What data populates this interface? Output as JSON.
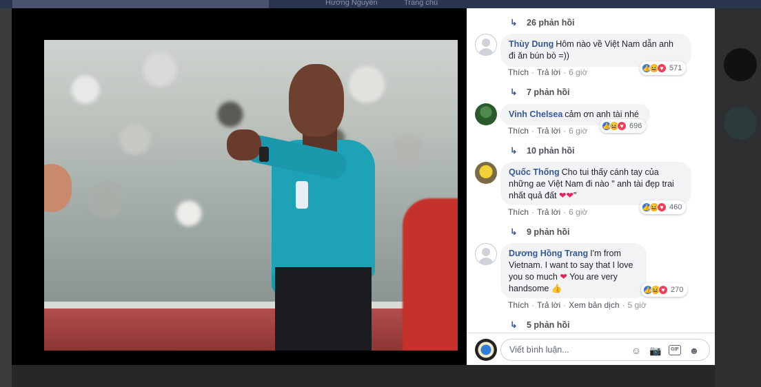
{
  "background": {
    "user_name": "Hương Nguyễn",
    "home": "Trang chủ"
  },
  "viewer": {
    "photo_alt": "Referee in teal FIFA jersey pointing"
  },
  "comments_panel": {
    "top_replies": "26 phản hồi",
    "comments": [
      {
        "name": "Thùy Dung",
        "text_lines": [
          "Hôm nào về Việt Nam dẫn anh",
          "đi ăn bún bò =))"
        ],
        "reactions_count": "571",
        "actions": [
          "Thích",
          "Trả lời",
          "6 giờ"
        ],
        "replies": "7 phản hồi"
      },
      {
        "name": "Vinh Chelsea",
        "text_lines": [
          "cảm ơn anh tài nhé"
        ],
        "reactions_count": "696",
        "actions": [
          "Thích",
          "Trả lời",
          "6 giờ"
        ],
        "replies": "10 phản hồi"
      },
      {
        "name": "Quốc Thống",
        "text_lines": [
          "Cho tui thấy cánh tay của",
          "những ae Việt Nam đi nào \" anh tài đẹp trai",
          "nhất quả đất"
        ],
        "text_end": "\"",
        "reactions_count": "460",
        "actions": [
          "Thích",
          "Trả lời",
          "6 giờ"
        ],
        "replies": "9 phản hồi"
      },
      {
        "name": "Dương Hồng Trang",
        "text_lines": [
          "I'm from",
          "Vietnam. I want to say that I love",
          "you so much",
          "You are very",
          "handsome"
        ],
        "reactions_count": "270",
        "actions": [
          "Thích",
          "Trả lời",
          "Xem bản dịch",
          "5 giờ"
        ],
        "replies": "5 phản hồi"
      }
    ],
    "composer": {
      "placeholder": "Viết bình luận..."
    },
    "icons": [
      "emoji-icon",
      "camera-icon",
      "gif-icon",
      "sticker-icon"
    ]
  }
}
